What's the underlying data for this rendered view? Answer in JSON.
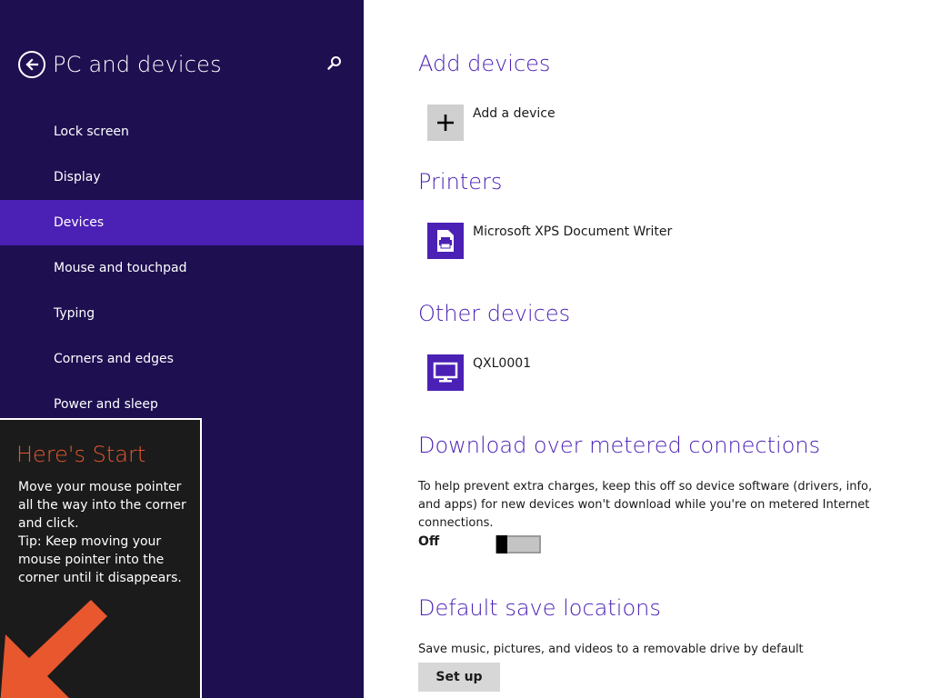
{
  "nav": {
    "title": "PC and devices",
    "items": [
      {
        "label": "Lock screen",
        "selected": false
      },
      {
        "label": "Display",
        "selected": false
      },
      {
        "label": "Devices",
        "selected": true
      },
      {
        "label": "Mouse and touchpad",
        "selected": false
      },
      {
        "label": "Typing",
        "selected": false
      },
      {
        "label": "Corners and edges",
        "selected": false
      },
      {
        "label": "Power and sleep",
        "selected": false
      }
    ],
    "back_icon": "back-arrow-circle-icon",
    "search_icon": "search-icon",
    "background_color": "#1e0f51",
    "accent_color": "#4b20b5"
  },
  "tip": {
    "title": "Here's Start",
    "body_line1": "Move your mouse pointer all the way into the corner and click.",
    "body_line2": "Tip: Keep moving your mouse pointer into the corner until it disappears.",
    "title_color": "#e8572e",
    "arrow_color": "#e8572e"
  },
  "main": {
    "add_devices": {
      "heading": "Add devices",
      "add_label": "Add a device"
    },
    "printers": {
      "heading": "Printers",
      "items": [
        "Microsoft XPS Document Writer"
      ]
    },
    "other_devices": {
      "heading": "Other devices",
      "items": [
        "QXL0001"
      ]
    },
    "metered": {
      "heading": "Download over metered connections",
      "description": "To help prevent extra charges, keep this off so device software (drivers, info, and apps) for new devices won't download while you're on metered Internet connections.",
      "toggle_state": "Off"
    },
    "save_locations": {
      "heading": "Default save locations",
      "description": "Save music, pictures, and videos to a removable drive by default",
      "button_label": "Set up"
    }
  }
}
